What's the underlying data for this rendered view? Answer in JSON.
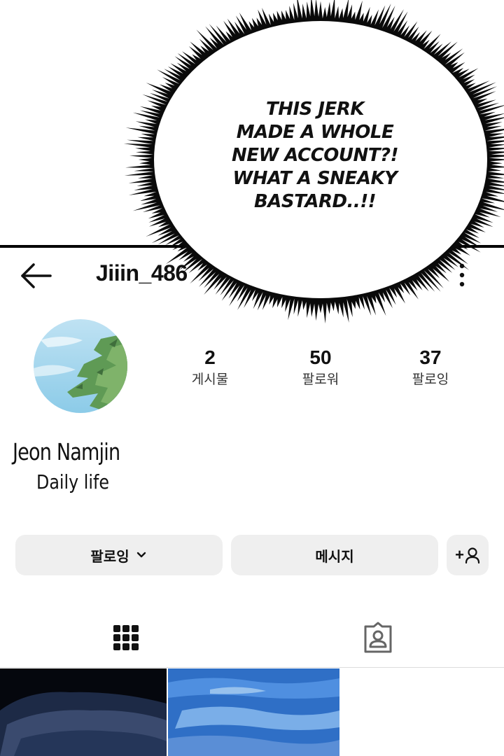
{
  "speech_bubble": {
    "lines": [
      "THIS JERK",
      "MADE A WHOLE",
      "NEW ACCOUNT?!",
      "WHAT A SNEAKY",
      "BASTARD..!!"
    ]
  },
  "profile": {
    "username": "Jiiin_486",
    "display_name": "Jeon Namjin",
    "bio": "Daily life",
    "stats": [
      {
        "value": "2",
        "label": "게시물"
      },
      {
        "value": "50",
        "label": "팔로워"
      },
      {
        "value": "37",
        "label": "팔로잉"
      }
    ]
  },
  "actions": {
    "following_label": "팔로잉",
    "message_label": "메시지",
    "add_user_glyph": "+"
  },
  "icons": {
    "back": "arrow-left-icon",
    "more": "more-vertical-icon",
    "grid": "grid-icon",
    "tagged": "tagged-person-icon",
    "chevron": "chevron-down-icon",
    "add_user": "add-user-icon"
  },
  "colors": {
    "button_bg": "#efefef",
    "text": "#111111",
    "thumb_1": "#05070d",
    "thumb_2": "#3a7bd0"
  }
}
